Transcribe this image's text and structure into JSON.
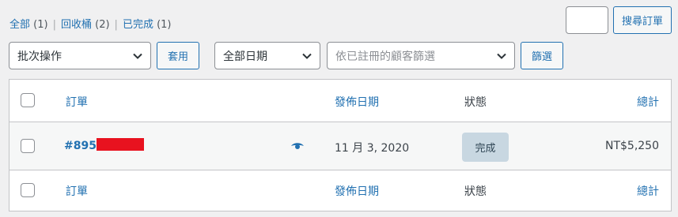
{
  "views": [
    {
      "label": "全部",
      "count": "(1)"
    },
    {
      "label": "回收桶",
      "count": "(2)"
    },
    {
      "label": "已完成",
      "count": "(1)"
    }
  ],
  "separator": "|",
  "search": {
    "value": "",
    "button": "搜尋訂單"
  },
  "bulk": {
    "selected": "批次操作",
    "apply": "套用"
  },
  "date_filter": {
    "selected": "全部日期"
  },
  "customer_filter": {
    "placeholder": "依已註冊的顧客篩選"
  },
  "filter_button": "篩選",
  "columns": {
    "order": "訂單",
    "date": "發佈日期",
    "status": "狀態",
    "total": "總計"
  },
  "rows": [
    {
      "order": "#895",
      "date": "11 月 3, 2020",
      "status": "完成",
      "total": "NT$5,250"
    }
  ],
  "colors": {
    "accent": "#2271b1",
    "redaction": "#e8121f",
    "status_bg": "#c8d7e1"
  },
  "icons": [
    "chevron-down-icon",
    "eye-icon"
  ]
}
